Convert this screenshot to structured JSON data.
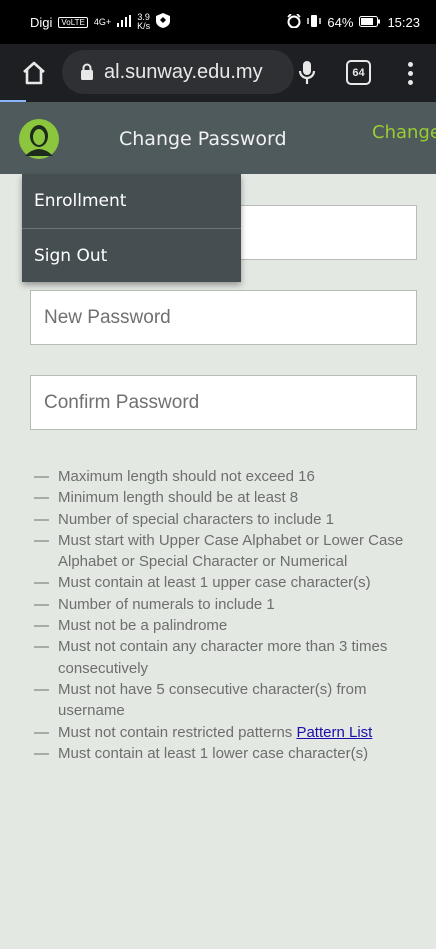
{
  "status_bar": {
    "carrier": "Digi",
    "volte": "VoLTE",
    "network": "4G+",
    "speed_value": "3.9",
    "speed_unit": "K/s",
    "battery": "64%",
    "time": "15:23"
  },
  "browser": {
    "url": "al.sunway.edu.my",
    "tab_count": "64"
  },
  "header": {
    "title": "Change Password",
    "action_label": "Change"
  },
  "menu": {
    "items": [
      {
        "label": "Enrollment"
      },
      {
        "label": "Sign Out"
      }
    ]
  },
  "form": {
    "new_password_placeholder": "New Password",
    "confirm_password_placeholder": "Confirm Password"
  },
  "rules": {
    "dash": "—",
    "items": [
      "Maximum length should not exceed 16",
      "Minimum length should be at least 8",
      "Number of special characters to include 1",
      "Must start with Upper Case Alphabet or Lower Case Alphabet or Special Character or Numerical",
      "Must contain at least 1 upper case character(s)",
      "Number of numerals to include 1",
      "Must not be a palindrome",
      "Must not contain any character more than 3 times consecutively",
      "Must not have 5 consecutive character(s) from username",
      "Must not contain restricted patterns",
      "Must contain at least 1 lower case character(s)"
    ],
    "pattern_link_label": "Pattern List"
  },
  "colors": {
    "header_bg": "#4e5a5c",
    "accent_green": "#9acd32",
    "page_bg": "#e3e8e3",
    "link": "#1a0dab"
  }
}
